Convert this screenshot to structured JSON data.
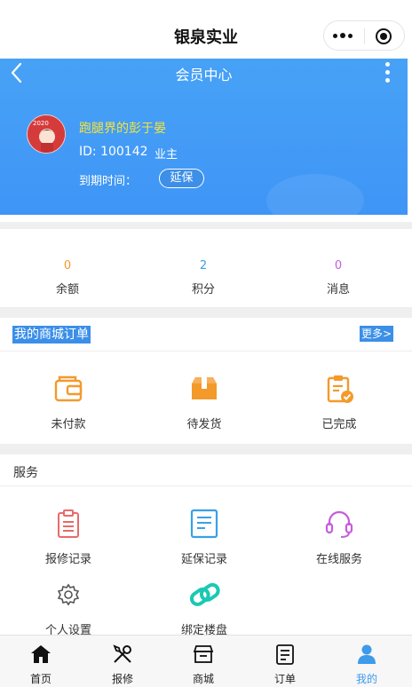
{
  "app": {
    "title": "银泉实业"
  },
  "header": {
    "title": "会员中心"
  },
  "user": {
    "name": "跑腿界的彭于晏",
    "id_text": "ID: 100142",
    "role": "业主",
    "expire_label": "到期时间：",
    "extend_button": "延保"
  },
  "stats": [
    {
      "value": "0",
      "label": "余额",
      "color": "#f39a2b"
    },
    {
      "value": "2",
      "label": "积分",
      "color": "#3aa0e6"
    },
    {
      "value": "0",
      "label": "消息",
      "color": "#c65bdc"
    }
  ],
  "orders": {
    "title": "我的商城订单",
    "more": "更多>",
    "items": [
      {
        "label": "未付款",
        "icon": "wallet-icon"
      },
      {
        "label": "待发货",
        "icon": "package-icon"
      },
      {
        "label": "已完成",
        "icon": "clipboard-check-icon"
      }
    ]
  },
  "services": {
    "title": "服务",
    "items": [
      {
        "label": "报修记录",
        "icon": "clipboard-icon"
      },
      {
        "label": "延保记录",
        "icon": "document-icon"
      },
      {
        "label": "在线服务",
        "icon": "headset-icon"
      },
      {
        "label": "个人设置",
        "icon": "gear-icon"
      },
      {
        "label": "绑定楼盘",
        "icon": "link-icon"
      }
    ]
  },
  "tabbar": [
    {
      "label": "首页",
      "icon": "home-icon"
    },
    {
      "label": "报修",
      "icon": "tools-icon"
    },
    {
      "label": "商城",
      "icon": "shop-icon"
    },
    {
      "label": "订单",
      "icon": "order-icon"
    },
    {
      "label": "我的",
      "icon": "user-icon"
    }
  ],
  "colors": {
    "header_blue": "#47a2f6",
    "order_orange": "#f39a2b",
    "service_red": "#e86a6a",
    "service_blue": "#3aa0e6",
    "service_purple": "#c65bdc",
    "service_teal": "#1ac9b3",
    "active_tab": "#3d9be9"
  }
}
